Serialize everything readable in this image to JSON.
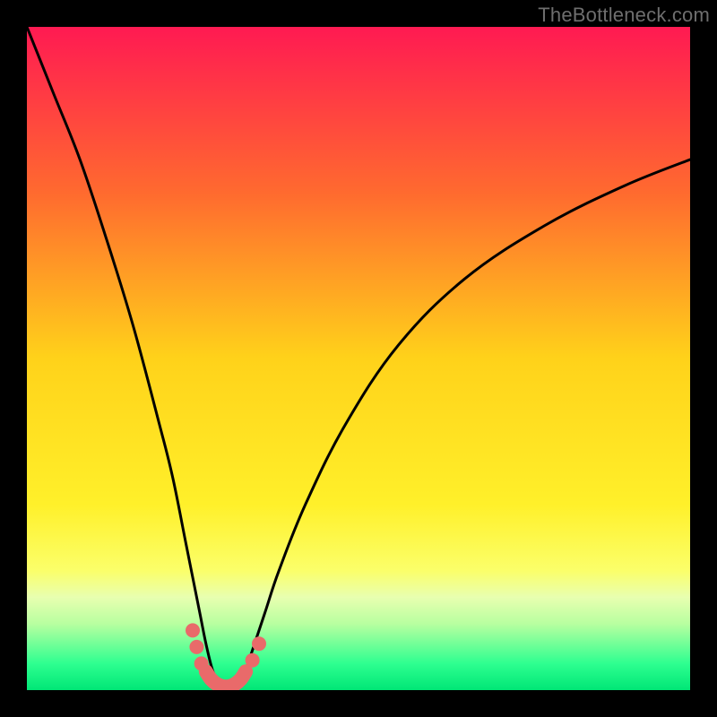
{
  "watermark": "TheBottleneck.com",
  "chart_data": {
    "type": "line",
    "title": "",
    "xlabel": "",
    "ylabel": "",
    "xlim": [
      0,
      100
    ],
    "ylim": [
      0,
      100
    ],
    "grid": false,
    "legend": false,
    "background_gradient_stops": [
      {
        "offset": 0.0,
        "color": "#ff1a52"
      },
      {
        "offset": 0.25,
        "color": "#ff6a2f"
      },
      {
        "offset": 0.5,
        "color": "#ffd21a"
      },
      {
        "offset": 0.72,
        "color": "#fff02a"
      },
      {
        "offset": 0.82,
        "color": "#fbff6a"
      },
      {
        "offset": 0.86,
        "color": "#e8ffb0"
      },
      {
        "offset": 0.9,
        "color": "#b8ffa0"
      },
      {
        "offset": 0.96,
        "color": "#2eff90"
      },
      {
        "offset": 1.0,
        "color": "#00e676"
      }
    ],
    "series": [
      {
        "name": "bottleneck-curve",
        "color": "#000000",
        "x": [
          0,
          4,
          8,
          12,
          16,
          20,
          22,
          24,
          26,
          27,
          28,
          29,
          30,
          31,
          32,
          33,
          34,
          36,
          38,
          42,
          48,
          56,
          66,
          78,
          90,
          100
        ],
        "values": [
          100,
          90,
          80,
          68,
          55,
          40,
          32,
          22,
          12,
          7,
          3,
          1,
          0,
          0,
          1,
          3,
          6,
          12,
          18,
          28,
          40,
          52,
          62,
          70,
          76,
          80
        ]
      }
    ],
    "markers": {
      "name": "dip-markers",
      "color": "#e96a6a",
      "shape": "circle",
      "points": [
        {
          "x": 25.0,
          "y": 9.0
        },
        {
          "x": 25.6,
          "y": 6.5
        },
        {
          "x": 26.3,
          "y": 4.0
        },
        {
          "x": 34.0,
          "y": 4.5
        },
        {
          "x": 35.0,
          "y": 7.0
        }
      ]
    },
    "dip_band": {
      "name": "dip-band",
      "color": "#e96a6a",
      "x": [
        27.0,
        27.8,
        28.8,
        30.0,
        31.2,
        32.2,
        33.0
      ],
      "values": [
        2.8,
        1.6,
        0.8,
        0.5,
        0.8,
        1.6,
        2.8
      ]
    }
  }
}
